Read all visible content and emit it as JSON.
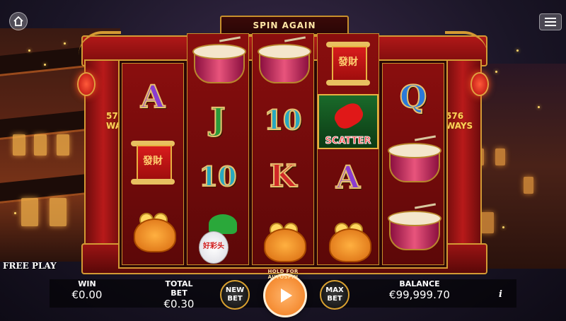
{
  "banner": {
    "title": "SPIN AGAIN"
  },
  "side": {
    "ways_left": "576 WAYS",
    "ways_right": "576 WAYS"
  },
  "reels": [
    [
      "A",
      "fortune-scroll",
      "gold-bag"
    ],
    [
      "drum",
      "J",
      "10",
      "radish"
    ],
    [
      "drum",
      "10",
      "K",
      "gold-bag"
    ],
    [
      "fortune-scroll",
      "scatter",
      "A",
      "gold-bag"
    ],
    [
      "Q",
      "drum",
      "drum"
    ]
  ],
  "symbols": {
    "A": "A",
    "J": "J",
    "K": "K",
    "Q": "Q",
    "ten": "10",
    "scatter_label": "SCATTER",
    "scroll_text": "發財",
    "radish_text": "好彩头"
  },
  "mode": {
    "label": "FREE PLAY"
  },
  "stats": {
    "win_label": "WIN",
    "win_value": "€0.00",
    "bet_label": "TOTAL BET",
    "bet_value": "€0.30",
    "balance_label": "BALANCE",
    "balance_value": "€99,999.70"
  },
  "buttons": {
    "new_bet_1": "NEW",
    "new_bet_2": "BET",
    "max_bet_1": "MAX",
    "max_bet_2": "BET",
    "autospin_hint": "HOLD FOR AUTOSPIN",
    "info": "i"
  },
  "colors": {
    "accent": "#d39a34",
    "frame_red": "#b01818",
    "spin_orange": "#f07a1a"
  },
  "icons": {
    "home": "home-icon",
    "menu": "hamburger-menu-icon",
    "spin": "play-arrow-icon"
  }
}
